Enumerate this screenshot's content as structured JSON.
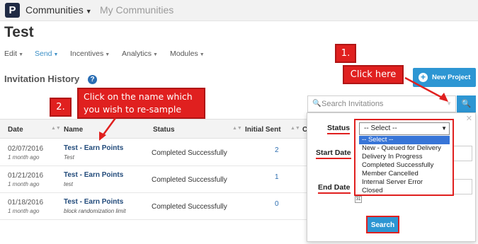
{
  "topbar": {
    "logo": "P",
    "app_menu": "Communities",
    "my_communities": "My Communities"
  },
  "page": {
    "title": "Test"
  },
  "nav": {
    "items": [
      {
        "label": "Edit",
        "active": false
      },
      {
        "label": "Send",
        "active": true
      },
      {
        "label": "Incentives",
        "active": false
      },
      {
        "label": "Analytics",
        "active": false
      },
      {
        "label": "Modules",
        "active": false
      }
    ]
  },
  "section": {
    "title": "Invitation History",
    "help": "?"
  },
  "new_project": {
    "label": "New Project"
  },
  "search": {
    "placeholder": "Search Invitations"
  },
  "table": {
    "headers": {
      "date": "Date",
      "name": "Name",
      "status": "Status",
      "initial_sent": "Initial Sent",
      "clipped": "C"
    },
    "rows": [
      {
        "date": "02/07/2016",
        "ago": "1 month ago",
        "name": "Test - Earn Points",
        "sub": "Test",
        "status": "Completed Successfully",
        "sent": "2"
      },
      {
        "date": "01/21/2016",
        "ago": "1 month ago",
        "name": "Test - Earn Points",
        "sub": "test",
        "status": "Completed Successfully",
        "sent": "1"
      },
      {
        "date": "01/18/2016",
        "ago": "1 month ago",
        "name": "Test - Earn Points",
        "sub": "block randomization limit",
        "status": "Completed Successfully",
        "sent": "0"
      }
    ]
  },
  "popup": {
    "status_label": "Status",
    "start_label": "Start Date",
    "end_label": "End Date",
    "calendar": "31",
    "close": "✕",
    "search_button": "Search",
    "select_value": "-- Select --",
    "options": [
      "-- Select --",
      "New - Queued for Delivery",
      "Delivery In Progress",
      "Completed Successfully",
      "Member Cancelled",
      "Internal Server Error",
      "Closed"
    ]
  },
  "callouts": {
    "one": "1.",
    "click_here": "Click here",
    "two": "2.",
    "resample": "Click on the name which you wish to re-sample"
  },
  "colors": {
    "accent": "#2d96d3",
    "callout": "#e0201f",
    "logo_bg": "#1f2a44"
  }
}
